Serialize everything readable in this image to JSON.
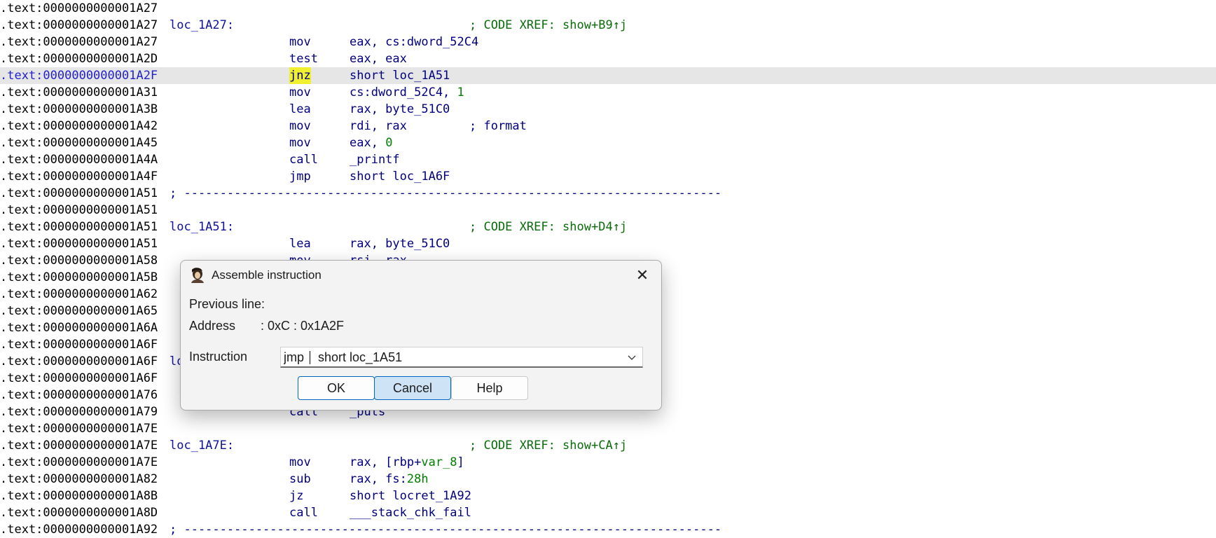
{
  "listing": [
    {
      "addr": ".text:0000000000001A27"
    },
    {
      "addr": ".text:0000000000001A27",
      "label": "loc_1A27:",
      "comment": "; CODE XREF: show+B9↑j"
    },
    {
      "addr": ".text:0000000000001A27",
      "mnem": "mov",
      "ops": "eax, cs:dword_52C4"
    },
    {
      "addr": ".text:0000000000001A2D",
      "mnem": "test",
      "ops": "eax, eax"
    },
    {
      "addr": ".text:0000000000001A2F",
      "mnem": "jnz",
      "ops": "short loc_1A51",
      "highlight": true
    },
    {
      "addr": ".text:0000000000001A31",
      "mnem": "mov",
      "ops": "cs:dword_52C4, ",
      "ops_num": "1"
    },
    {
      "addr": ".text:0000000000001A3B",
      "mnem": "lea",
      "ops": "rax, byte_51C0"
    },
    {
      "addr": ".text:0000000000001A42",
      "mnem": "mov",
      "ops": "rdi, rax",
      "comment": "; format",
      "comment_blue": true
    },
    {
      "addr": ".text:0000000000001A45",
      "mnem": "mov",
      "ops": "eax, ",
      "ops_num": "0"
    },
    {
      "addr": ".text:0000000000001A4A",
      "mnem": "call",
      "ops": "_printf"
    },
    {
      "addr": ".text:0000000000001A4F",
      "mnem": "jmp",
      "ops": "short loc_1A6F"
    },
    {
      "addr": ".text:0000000000001A51",
      "separator": "; ---------------------------------------------------------------------------"
    },
    {
      "addr": ".text:0000000000001A51"
    },
    {
      "addr": ".text:0000000000001A51",
      "label": "loc_1A51:",
      "comment": "; CODE XREF: show+D4↑j"
    },
    {
      "addr": ".text:0000000000001A51",
      "mnem": "lea",
      "ops": "rax, byte_51C0"
    },
    {
      "addr": ".text:0000000000001A58",
      "mnem": "mov",
      "ops": "rsi, rax"
    },
    {
      "addr": ".text:0000000000001A5B"
    },
    {
      "addr": ".text:0000000000001A62"
    },
    {
      "addr": ".text:0000000000001A65"
    },
    {
      "addr": ".text:0000000000001A6A"
    },
    {
      "addr": ".text:0000000000001A6F"
    },
    {
      "addr": ".text:0000000000001A6F",
      "label": "lo"
    },
    {
      "addr": ".text:0000000000001A6F"
    },
    {
      "addr": ".text:0000000000001A76"
    },
    {
      "addr": ".text:0000000000001A79",
      "mnem": "call",
      "ops": "_puts"
    },
    {
      "addr": ".text:0000000000001A7E"
    },
    {
      "addr": ".text:0000000000001A7E",
      "label": "loc_1A7E:",
      "comment": "; CODE XREF: show+CA↑j"
    },
    {
      "addr": ".text:0000000000001A7E",
      "mnem": "mov",
      "ops": "rax, [rbp+",
      "ops_num": "var_8",
      "ops_tail": "]"
    },
    {
      "addr": ".text:0000000000001A82",
      "mnem": "sub",
      "ops": "rax, fs:",
      "ops_num": "28h"
    },
    {
      "addr": ".text:0000000000001A8B",
      "mnem": "jz",
      "ops": "short locret_1A92"
    },
    {
      "addr": ".text:0000000000001A8D",
      "mnem": "call",
      "ops": "___stack_chk_fail"
    },
    {
      "addr": ".text:0000000000001A92",
      "separator": "; ---------------------------------------------------------------------------"
    }
  ],
  "dialog": {
    "title": "Assemble instruction",
    "previous_line_label": "Previous line:",
    "address_label": "Address",
    "address_value": ":  0xC  :  0x1A2F",
    "instruction_label": "Instruction",
    "instruction_value": "jmp    short loc_1A51",
    "buttons": {
      "ok": "OK",
      "cancel": "Cancel",
      "help": "Help"
    }
  }
}
